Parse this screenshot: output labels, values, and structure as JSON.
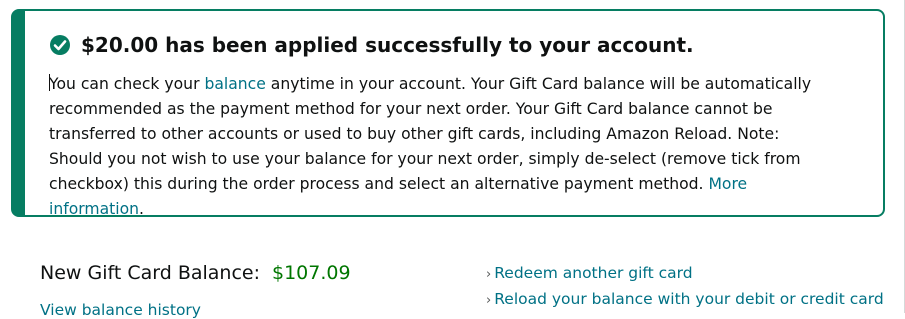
{
  "alert": {
    "heading": "$20.00 has been applied successfully to your account.",
    "icon": "check-circle-icon",
    "body_start": "You can check your ",
    "balance_link": "balance",
    "body_middle": " anytime in your account. Your Gift Card balance will be automatically recommended as the payment method for your next order. Your Gift Card balance cannot be transferred to other accounts or used to buy other gift cards, including Amazon Reload. Note: Should you not wish to use your balance for your next order, simply de-select (remove tick from checkbox) this during the order process and select an alternative payment method. ",
    "more_info_link": "More information",
    "body_end": ".",
    "accent_color": "#067d62"
  },
  "balance": {
    "label": "New Gift Card Balance:",
    "amount": "$107.09",
    "amount_color": "#007600"
  },
  "actions": {
    "chevron": "›",
    "redeem_label": "Redeem another gift card",
    "reload_label": "Reload your balance with your debit or credit card"
  },
  "view_history": {
    "label": "View balance history"
  },
  "link_color": "#007185"
}
